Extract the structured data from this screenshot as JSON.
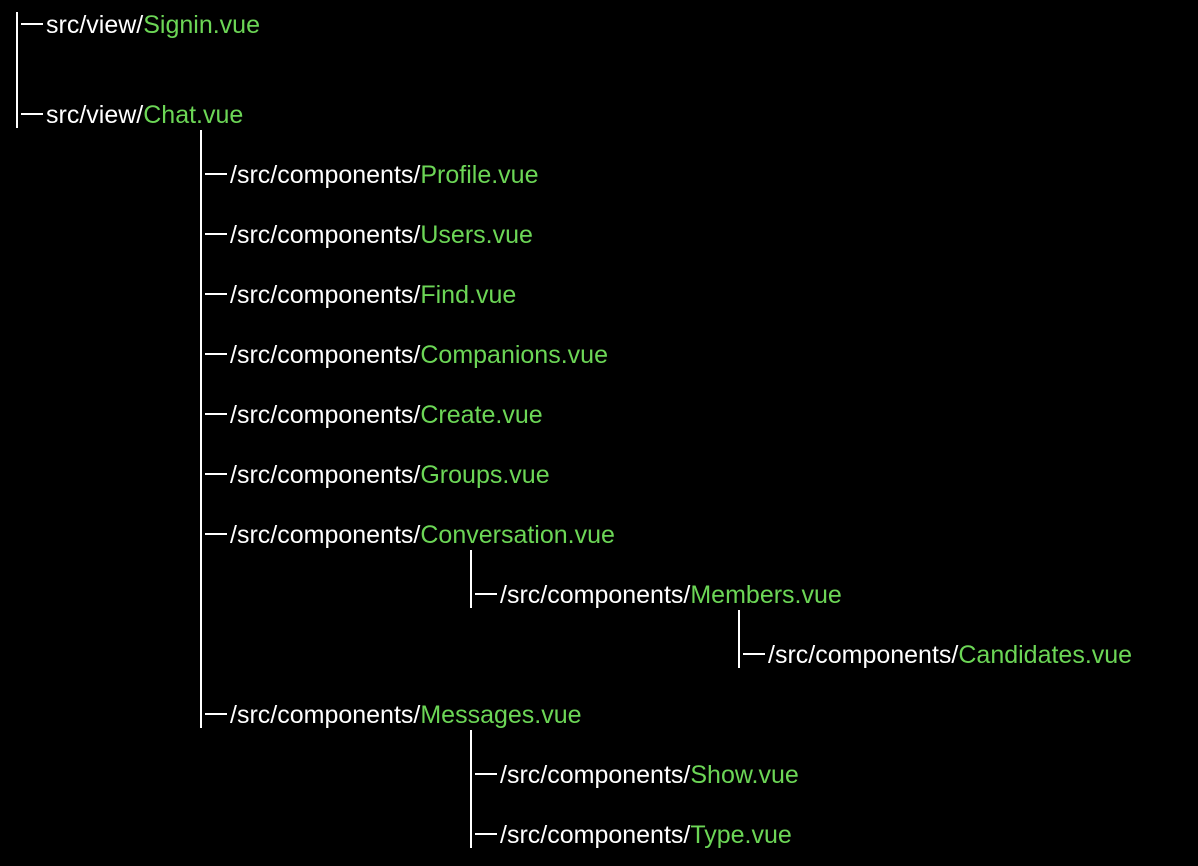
{
  "colors": {
    "background": "#000000",
    "path_text": "#ffffff",
    "file_text": "#6cd656"
  },
  "nodes": [
    {
      "id": "signin",
      "parent": null,
      "path": "src/view/",
      "file": "Signin.vue"
    },
    {
      "id": "chat",
      "parent": null,
      "path": "src/view/",
      "file": "Chat.vue"
    },
    {
      "id": "profile",
      "parent": "chat",
      "path": "/src/components/",
      "file": "Profile.vue"
    },
    {
      "id": "users",
      "parent": "chat",
      "path": "/src/components/",
      "file": "Users.vue"
    },
    {
      "id": "find",
      "parent": "chat",
      "path": "/src/components/",
      "file": "Find.vue"
    },
    {
      "id": "companions",
      "parent": "chat",
      "path": "/src/components/",
      "file": "Companions.vue"
    },
    {
      "id": "create",
      "parent": "chat",
      "path": "/src/components/",
      "file": "Create.vue"
    },
    {
      "id": "groups",
      "parent": "chat",
      "path": "/src/components/",
      "file": "Groups.vue"
    },
    {
      "id": "conversation",
      "parent": "chat",
      "path": "/src/components/",
      "file": "Conversation.vue"
    },
    {
      "id": "members",
      "parent": "conversation",
      "path": "/src/components/",
      "file": "Members.vue"
    },
    {
      "id": "candidates",
      "parent": "members",
      "path": "/src/components/",
      "file": "Candidates.vue"
    },
    {
      "id": "messages",
      "parent": "chat",
      "path": "/src/components/",
      "file": "Messages.vue"
    },
    {
      "id": "show",
      "parent": "messages",
      "path": "/src/components/",
      "file": "Show.vue"
    },
    {
      "id": "type",
      "parent": "messages",
      "path": "/src/components/",
      "file": "Type.vue"
    }
  ]
}
